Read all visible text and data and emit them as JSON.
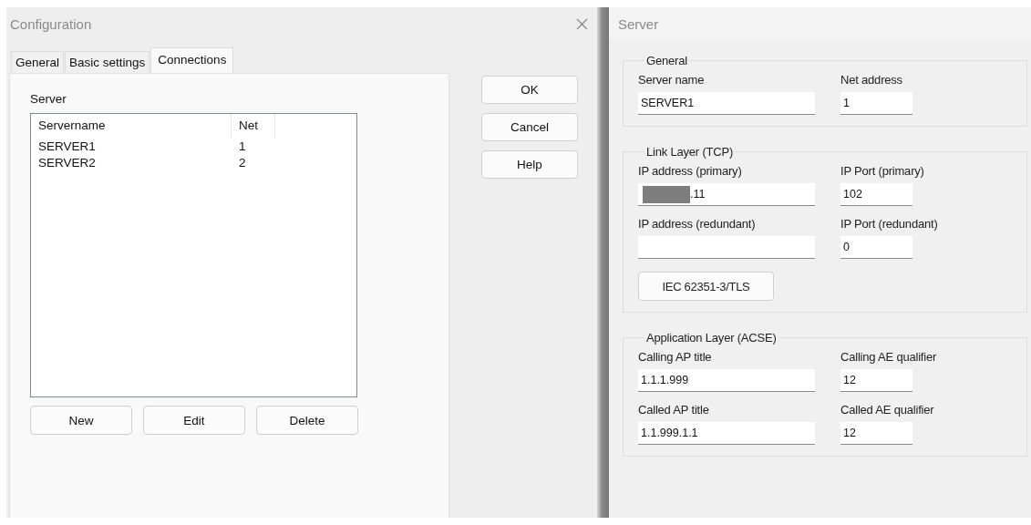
{
  "config_window": {
    "title": "Configuration",
    "tabs": [
      {
        "label": "General",
        "selected": false
      },
      {
        "label": "Basic settings",
        "selected": false
      },
      {
        "label": "Connections",
        "selected": true
      }
    ],
    "server_list": {
      "label": "Server",
      "columns": [
        "Servername",
        "Net"
      ],
      "rows": [
        {
          "cells": [
            "SERVER1",
            "1"
          ]
        },
        {
          "cells": [
            "SERVER2",
            "2"
          ]
        }
      ]
    },
    "list_buttons": [
      "New",
      "Edit",
      "Delete"
    ],
    "dialog_buttons": [
      "OK",
      "Cancel",
      "Help"
    ]
  },
  "server_window": {
    "title": "Server",
    "groups": [
      {
        "title": "General",
        "fields": [
          {
            "label": "Server name",
            "value": "SERVER1"
          },
          {
            "label": "Net address",
            "value": "1"
          }
        ]
      },
      {
        "title": "Link Layer (TCP)",
        "fields": [
          {
            "label": "IP address (primary)",
            "value": ".11",
            "redacted": true
          },
          {
            "label": "IP Port (primary)",
            "value": "102"
          },
          {
            "label": "IP address (redundant)"
          },
          {
            "label": "IP Port (redundant)",
            "value": "0"
          }
        ],
        "button": "IEC 62351-3/TLS"
      },
      {
        "title": "Application Layer (ACSE)",
        "fields": [
          {
            "label": "Calling AP title",
            "value": "1.1.1.999"
          },
          {
            "label": "Calling AE qualifier",
            "value": "12"
          },
          {
            "label": "Called AP title",
            "value": "1.1.999.1.1"
          },
          {
            "label": "Called AE qualifier",
            "value": "12"
          }
        ]
      }
    ]
  }
}
